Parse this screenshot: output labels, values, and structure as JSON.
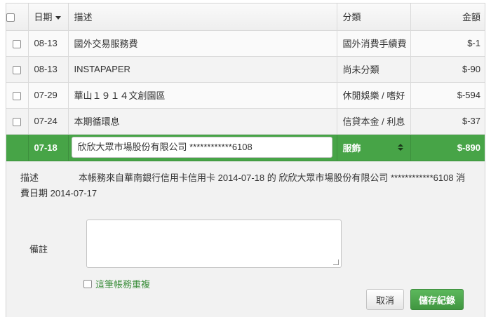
{
  "table": {
    "headers": {
      "date": "日期",
      "description": "描述",
      "category": "分類",
      "amount": "金額"
    },
    "rows": [
      {
        "date": "08-13",
        "description": "國外交易服務費",
        "category": "國外消費手續費",
        "amount": "$-1"
      },
      {
        "date": "08-13",
        "description": "INSTAPAPER",
        "category": "尚未分類",
        "amount": "$-90"
      },
      {
        "date": "07-29",
        "description": "華山１９１４文創園區",
        "category": "休閒娛樂 / 嗜好",
        "amount": "$-594"
      },
      {
        "date": "07-24",
        "description": "本期循環息",
        "category": "信貸本金 / 利息",
        "amount": "$-37"
      }
    ],
    "selected": {
      "date": "07-18",
      "description": "欣欣大眾市場股份有限公司 ************6108",
      "category": "服飾",
      "amount": "$-890"
    }
  },
  "detail": {
    "label": "描述",
    "text": "本帳務來自華南銀行信用卡信用卡 2014-07-18 的 欣欣大眾市場股份有限公司 ************6108 消費日期 2014-07-17"
  },
  "note": {
    "label": "備註",
    "value": ""
  },
  "duplicate": {
    "label": "這筆帳務重複"
  },
  "buttons": {
    "cancel": "取消",
    "save": "儲存紀錄"
  },
  "colors": {
    "accent": "#47a447",
    "link": "#3d8f3d"
  }
}
